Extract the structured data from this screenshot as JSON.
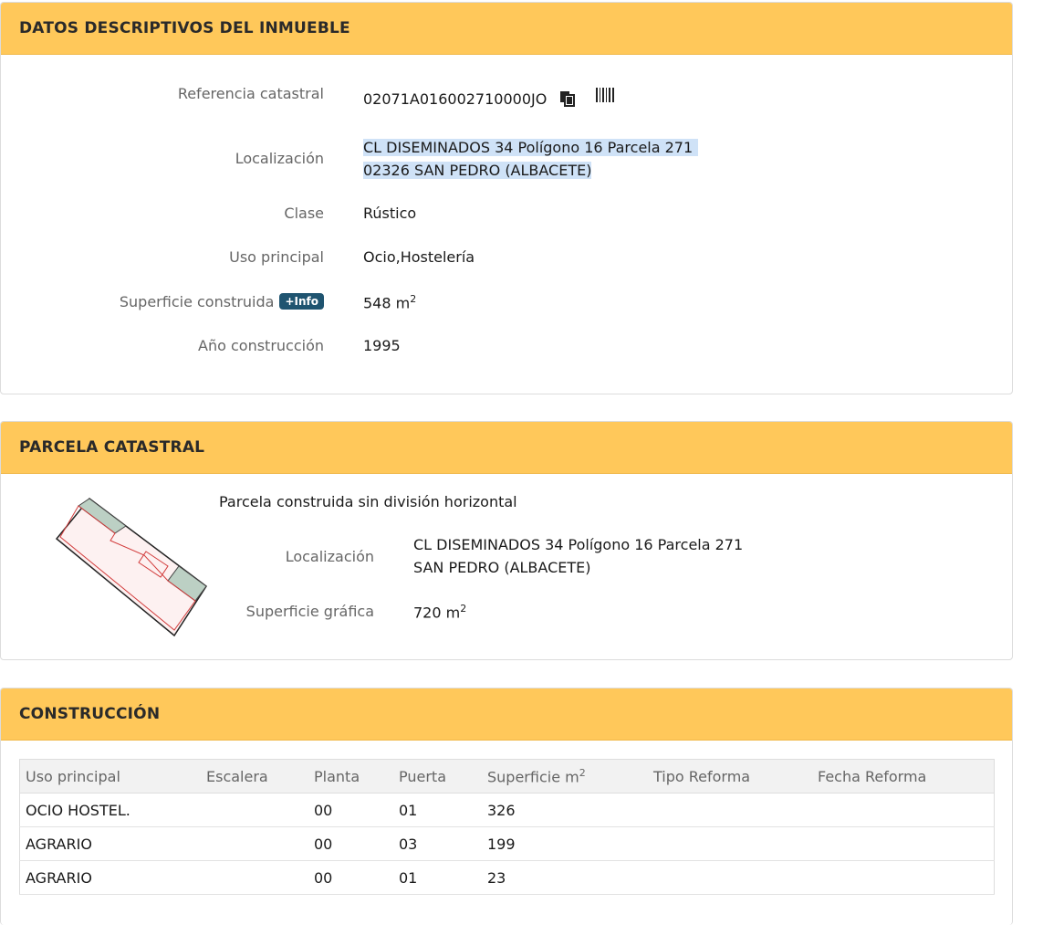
{
  "inmueble": {
    "title": "DATOS DESCRIPTIVOS DEL INMUEBLE",
    "referencia_label": "Referencia catastral",
    "referencia_value": "02071A016002710000JO",
    "localizacion_label": "Localización",
    "localizacion_line1": "CL DISEMINADOS 34 Polígono 16 Parcela 271",
    "localizacion_line2": "02326 SAN PEDRO (ALBACETE)",
    "clase_label": "Clase",
    "clase_value": "Rústico",
    "uso_label": "Uso principal",
    "uso_value": "Ocio,Hostelería",
    "superficie_label": "Superficie construida",
    "info_badge": "+Info",
    "superficie_value": "548 m",
    "superficie_exp": "2",
    "anio_label": "Año construcción",
    "anio_value": "1995"
  },
  "parcela": {
    "title": "PARCELA CATASTRAL",
    "tipo": "Parcela construida sin división horizontal",
    "localizacion_label": "Localización",
    "localizacion_line1": "CL DISEMINADOS 34 Polígono 16 Parcela 271",
    "localizacion_line2": "SAN PEDRO (ALBACETE)",
    "superficie_label": "Superficie gráfica",
    "superficie_value": "720 m",
    "superficie_exp": "2"
  },
  "construccion": {
    "title": "CONSTRUCCIÓN",
    "headers": {
      "uso": "Uso principal",
      "escalera": "Escalera",
      "planta": "Planta",
      "puerta": "Puerta",
      "superficie": "Superficie m",
      "superficie_exp": "2",
      "tipo_reforma": "Tipo Reforma",
      "fecha_reforma": "Fecha Reforma"
    },
    "rows": [
      {
        "uso": "OCIO HOSTEL.",
        "escalera": "",
        "planta": "00",
        "puerta": "01",
        "superficie": "326",
        "tipo_reforma": "",
        "fecha_reforma": ""
      },
      {
        "uso": "AGRARIO",
        "escalera": "",
        "planta": "00",
        "puerta": "03",
        "superficie": "199",
        "tipo_reforma": "",
        "fecha_reforma": ""
      },
      {
        "uso": "AGRARIO",
        "escalera": "",
        "planta": "00",
        "puerta": "01",
        "superficie": "23",
        "tipo_reforma": "",
        "fecha_reforma": ""
      }
    ]
  },
  "icons": {
    "copy": "copy-icon",
    "barcode": "barcode-icon",
    "parcel_map": "parcel-map-icon"
  },
  "colors": {
    "header_bg": "#ffc85a",
    "badge_bg": "#1f5470",
    "selection": "#cfe2f7"
  }
}
